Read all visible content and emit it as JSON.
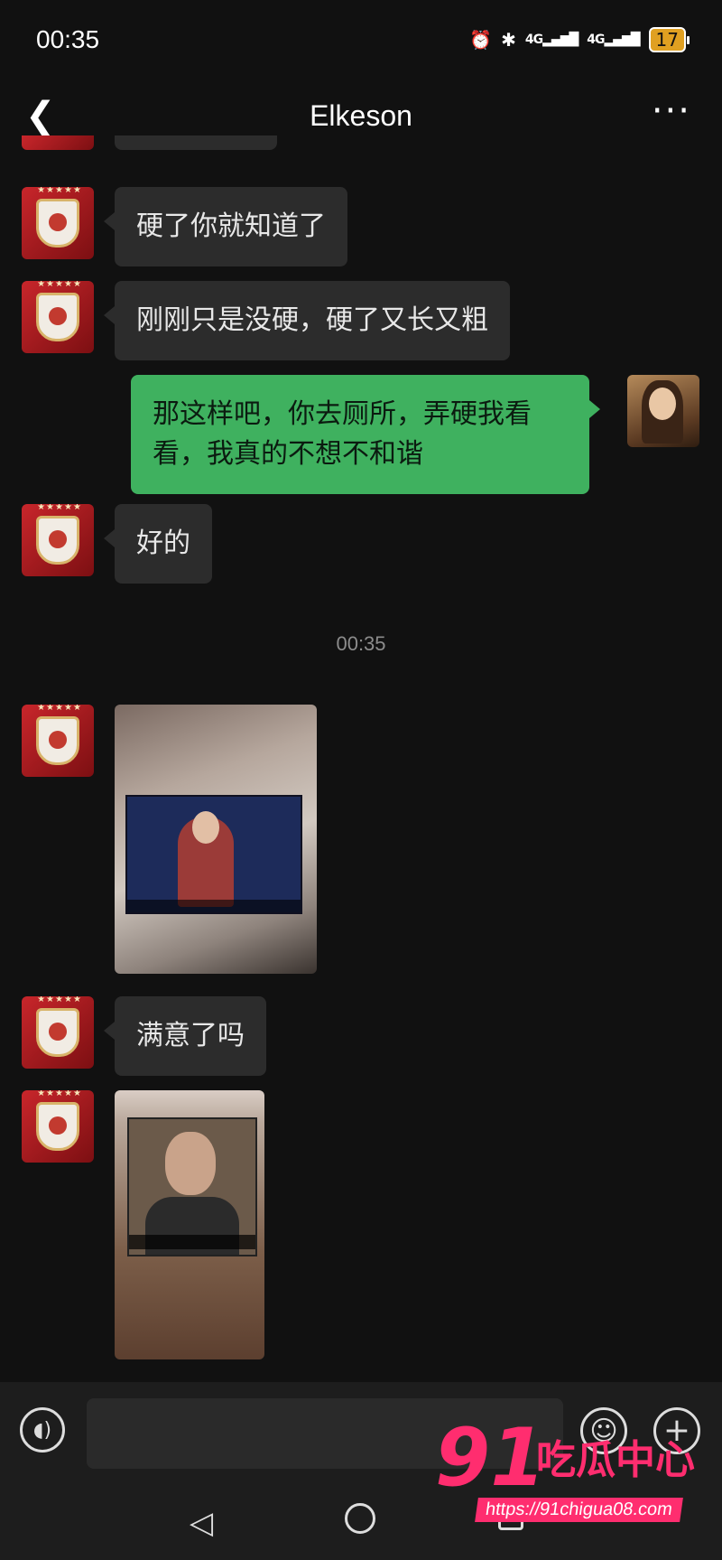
{
  "status_bar": {
    "time": "00:35",
    "net1": "4G",
    "net2": "4G",
    "battery": "17"
  },
  "header": {
    "title": "Elkeson"
  },
  "messages": [
    {
      "sender": "contact",
      "type": "text",
      "text": "硬了你就知道了"
    },
    {
      "sender": "contact",
      "type": "text",
      "text": "刚刚只是没硬，硬了又长又粗"
    },
    {
      "sender": "me",
      "type": "text",
      "text": "那这样吧，你去厕所，弄硬我看看，我真的不想不和谐"
    },
    {
      "sender": "contact",
      "type": "text",
      "text": "好的"
    },
    {
      "sender": "contact",
      "type": "image"
    },
    {
      "sender": "contact",
      "type": "text",
      "text": "满意了吗"
    },
    {
      "sender": "contact",
      "type": "image"
    }
  ],
  "timestamp": "00:35",
  "watermark": {
    "number": "91",
    "text": "吃瓜中心",
    "url": "https://91chigua08.com"
  },
  "colors": {
    "background": "#111111",
    "bubble_incoming": "#2c2c2c",
    "bubble_outgoing": "#3fb15f",
    "watermark": "#ff2d6f"
  }
}
